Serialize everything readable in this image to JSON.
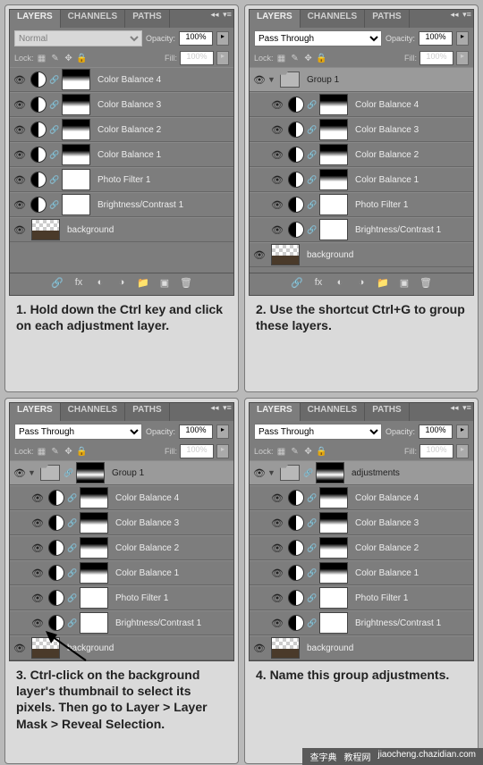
{
  "tabs": {
    "layers": "LAYERS",
    "channels": "CHANNELS",
    "paths": "PATHS"
  },
  "blendNormal": "Normal",
  "blendPass": "Pass Through",
  "opacityLabel": "Opacity:",
  "opacityVal": "100%",
  "lockLabel": "Lock:",
  "fillLabel": "Fill:",
  "fillVal": "100%",
  "layers": {
    "cb4": "Color Balance 4",
    "cb3": "Color Balance 3",
    "cb2": "Color Balance 2",
    "cb1": "Color Balance 1",
    "pf1": "Photo Filter 1",
    "bc1": "Brightness/Contrast 1",
    "bg": "background",
    "group1": "Group 1",
    "adjustments": "adjustments"
  },
  "captions": {
    "q1": "1. Hold down the Ctrl key and click on each adjustment layer.",
    "q2": "2. Use the shortcut Ctrl+G to group these layers.",
    "q3": "3. Ctrl-click on the background layer's thumbnail to select its pixels. Then go to Layer > Layer Mask > Reveal Selection.",
    "q4": "4. Name this group adjustments."
  },
  "footer": {
    "a": "查字典",
    "b": "教程网",
    "c": "jiaocheng.chazidian.com"
  }
}
